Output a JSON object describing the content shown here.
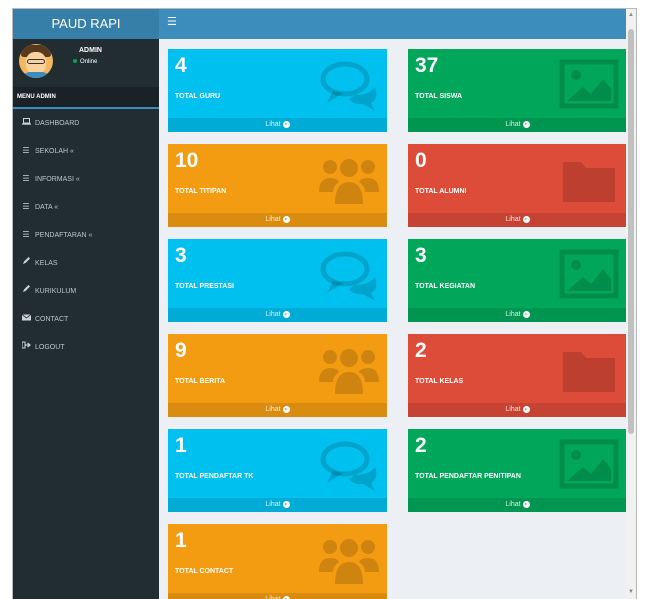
{
  "app": {
    "title": "PAUD RAPI"
  },
  "user": {
    "name": "ADMIN",
    "status": "Online"
  },
  "menu": {
    "header": "MENU ADMIN",
    "items": [
      {
        "label": "DASHBOARD",
        "icon": "laptop-icon"
      },
      {
        "label": "SEKOLAH «",
        "icon": "list-icon"
      },
      {
        "label": "INFORMASI «",
        "icon": "list-icon"
      },
      {
        "label": "DATA «",
        "icon": "list-icon"
      },
      {
        "label": "PENDAFTARAN «",
        "icon": "list-icon"
      },
      {
        "label": "KELAS",
        "icon": "pencil-icon"
      },
      {
        "label": "KURIKULUM",
        "icon": "pencil-icon"
      },
      {
        "label": "CONTACT",
        "icon": "envelope-icon"
      },
      {
        "label": "LOGOUT",
        "icon": "sign-out-icon"
      }
    ]
  },
  "colors": {
    "aqua": "#00c0ef",
    "green": "#00a65a",
    "yellow": "#f39c12",
    "red": "#dd4b39",
    "sidebar": "#222d32",
    "header": "#3c8dbc"
  },
  "boxes": [
    {
      "count": "4",
      "label": "TOTAL GURU",
      "link": "Lihat",
      "color": "aqua",
      "icon": "comments-icon"
    },
    {
      "count": "37",
      "label": "TOTAL SISWA",
      "link": "Lihat",
      "color": "green",
      "icon": "image-icon"
    },
    {
      "count": "10",
      "label": "TOTAL TITIPAN",
      "link": "Lihat",
      "color": "yellow",
      "icon": "users-icon"
    },
    {
      "count": "0",
      "label": "TOTAL ALUMNI",
      "link": "Lihat",
      "color": "red",
      "icon": "folder-icon"
    },
    {
      "count": "3",
      "label": "TOTAL PRESTASI",
      "link": "Lihat",
      "color": "aqua",
      "icon": "comments-icon"
    },
    {
      "count": "3",
      "label": "TOTAL KEGIATAN",
      "link": "Lihat",
      "color": "green",
      "icon": "image-icon"
    },
    {
      "count": "9",
      "label": "TOTAL BERITA",
      "link": "Lihat",
      "color": "yellow",
      "icon": "users-icon"
    },
    {
      "count": "2",
      "label": "TOTAL KELAS",
      "link": "Lihat",
      "color": "red",
      "icon": "folder-icon"
    },
    {
      "count": "1",
      "label": "TOTAL PENDAFTAR TK",
      "link": "Lihat",
      "color": "aqua",
      "icon": "comments-icon"
    },
    {
      "count": "2",
      "label": "TOTAL PENDAFTAR PENITIPAN",
      "link": "Lihat",
      "color": "green",
      "icon": "image-icon"
    },
    {
      "count": "1",
      "label": "TOTAL CONTACT",
      "link": "Lihat",
      "color": "yellow",
      "icon": "users-icon"
    }
  ]
}
